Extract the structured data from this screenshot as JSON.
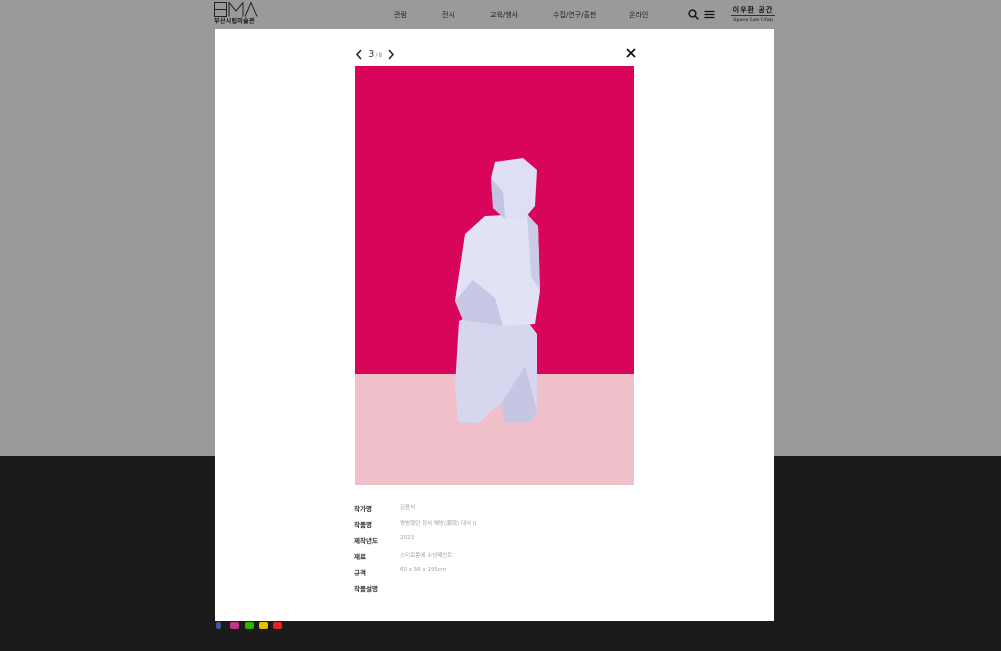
{
  "header": {
    "logo_letters": "BMA",
    "logo_text": "부산시립미술관",
    "nav": [
      "관람",
      "전시",
      "교육/행사",
      "수집/연구/출판",
      "온라인"
    ],
    "space": {
      "ko": "이우환 공간",
      "en": "Space Lee Ufan"
    }
  },
  "icons": {
    "search": "search-icon",
    "menu": "hamburger-menu-icon",
    "prev": "chevron-left-icon",
    "next": "chevron-right-icon",
    "close": "close-icon"
  },
  "social": [
    {
      "name": "facebook-icon",
      "color": "#3b5998"
    },
    {
      "name": "instagram-icon",
      "color": "#c13584"
    },
    {
      "name": "blog-icon",
      "color": "#2db400"
    },
    {
      "name": "kakao-icon",
      "color": "#e5c100"
    },
    {
      "name": "youtube-icon",
      "color": "#e62117"
    }
  ],
  "modal": {
    "pager": {
      "current": "3",
      "separator": "/",
      "total": "8"
    },
    "artwork_colors": {
      "wall": "#d8055b",
      "floor": "#f0c0ca",
      "sculpture": "#dcdcf2"
    },
    "details": [
      {
        "label": "작가명",
        "value": "김용석"
      },
      {
        "label": "작품명",
        "value": "평범했던 정서 해방(潮流) 대사 II"
      },
      {
        "label": "제작년도",
        "value": "2023"
      },
      {
        "label": "재료",
        "value": "스티로폼에 수성페인트"
      },
      {
        "label": "규격",
        "value": "60 x 56 x 195cm"
      },
      {
        "label": "작품설명",
        "value": ""
      }
    ]
  }
}
